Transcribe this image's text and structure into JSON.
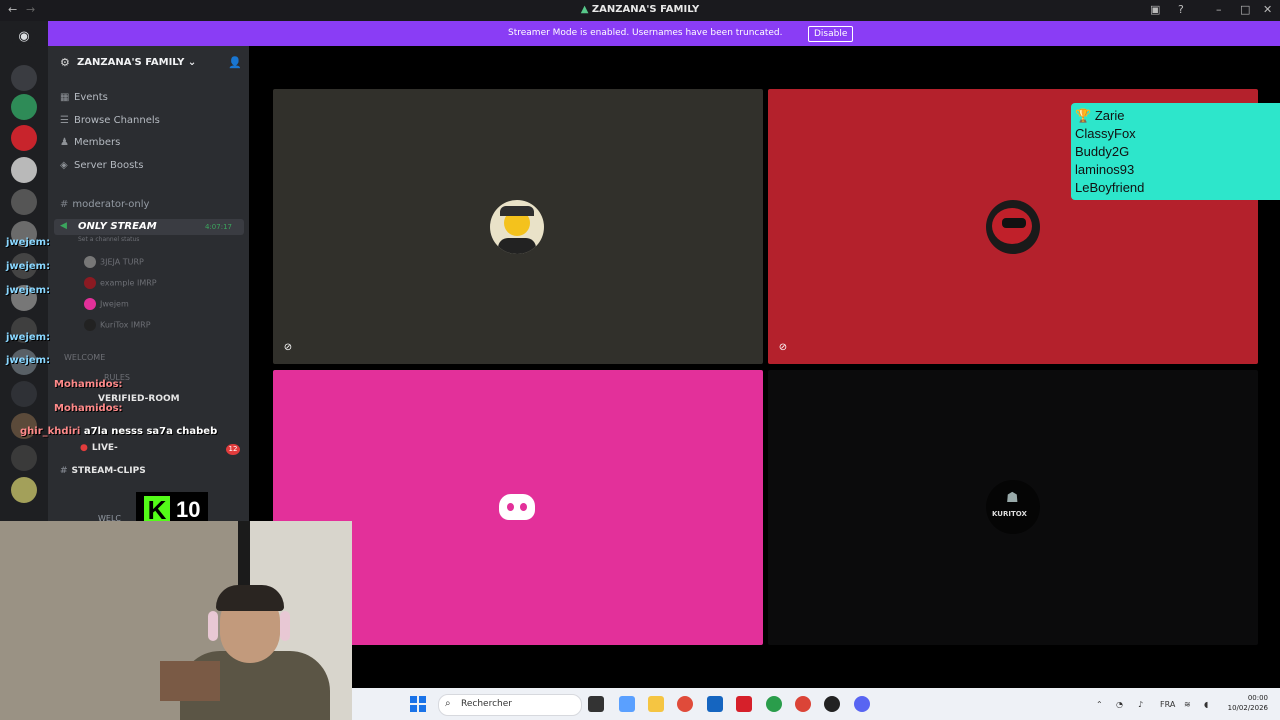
{
  "window": {
    "title": "ZANZANA'S FAMILY"
  },
  "banner": {
    "message": "Streamer Mode is enabled. Usernames have been truncated.",
    "disable_label": "Disable"
  },
  "server": {
    "name": "ZANZANA'S FAMILY ⌄",
    "nav": [
      {
        "label": "Events",
        "icon": "calendar-icon"
      },
      {
        "label": "Browse Channels",
        "icon": "hash-list-icon"
      },
      {
        "label": "Members",
        "icon": "people-icon"
      },
      {
        "label": "Server Boosts",
        "icon": "boost-icon"
      }
    ],
    "channels": {
      "moderator": "moderator-only",
      "stream": "ONLY STREAM",
      "stream_time": "4:07:17",
      "status": "Set a channel status",
      "voice_users": [
        {
          "name": "3JEJA",
          "tag": "TURP"
        },
        {
          "name": "example",
          "tag": "IMRP"
        },
        {
          "name": "Jwejem",
          "tag": ""
        },
        {
          "name": "KuriTox",
          "tag": "IMRP"
        }
      ],
      "welcome_category": "WELCOME",
      "rules": "RULES",
      "verified": "VERIFIED-ROOM",
      "live": "LIVE-",
      "live_badge": "12",
      "stream_clips": "STREAM-CLIPS",
      "welc": "WELC"
    }
  },
  "chat": [
    {
      "name": "jwejem:",
      "msg": ""
    },
    {
      "name": "jwejem:",
      "msg": ""
    },
    {
      "name": "jwejem:",
      "msg": ""
    },
    {
      "name": "jwejem:",
      "msg": ""
    },
    {
      "name": "jwejem:",
      "msg": ""
    },
    {
      "name": "Mohamidos:",
      "msg": ""
    },
    {
      "name": "Mohamidos:",
      "msg": ""
    },
    {
      "name": "ghir_khdiri",
      "msg": "a7la nesss sa7a chabeb"
    }
  ],
  "leaderboard": [
    "Zarie",
    "ClassyFox",
    "Buddy2G",
    "laminos93",
    "LeBoyfriend"
  ],
  "kick": {
    "logo": "K",
    "count": "10"
  },
  "tile4": {
    "label": "KURITOX"
  },
  "taskbar": {
    "search_placeholder": "Rechercher",
    "lang": "FRA",
    "time": "00:00",
    "date": "10/02/2026"
  },
  "colors": {
    "banner": "#8a3df5",
    "tile_dark": "#31302b",
    "tile_red": "#b4212c",
    "tile_pink": "#e3309a",
    "leaderboard": "#2de6cb",
    "kick_green": "#53fc18"
  }
}
